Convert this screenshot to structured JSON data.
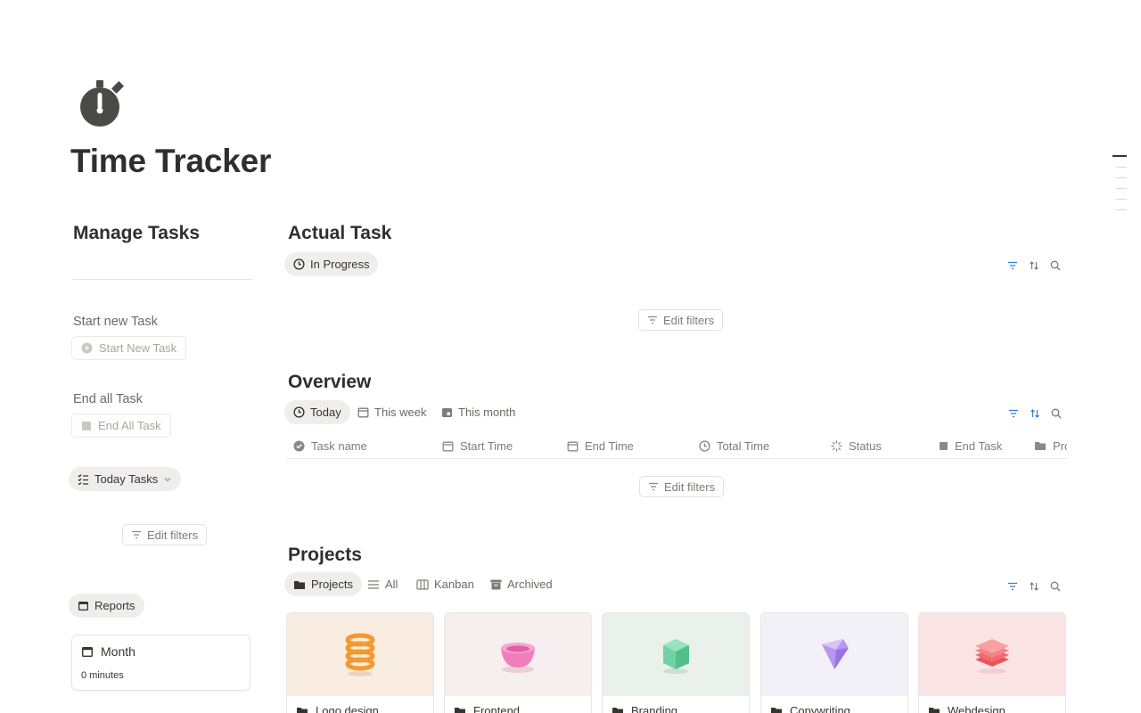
{
  "page": {
    "title": "Time Tracker",
    "icon": "stopwatch-icon"
  },
  "left": {
    "title": "Manage Tasks",
    "start_label": "Start new Task",
    "start_button": "Start New Task",
    "end_label": "End all Task",
    "end_button": "End All Task",
    "today_view": "Today Tasks",
    "edit_filters": "Edit filters",
    "reports_view": "Reports",
    "month_card": {
      "title": "Month",
      "value": "0 minutes"
    }
  },
  "actual_task": {
    "title": "Actual Task",
    "tab": "In Progress",
    "edit_filters": "Edit filters"
  },
  "overview": {
    "title": "Overview",
    "tabs": [
      "Today",
      "This week",
      "This month"
    ],
    "columns": [
      "Task name",
      "Start Time",
      "End Time",
      "Total Time",
      "Status",
      "End Task",
      "Pro"
    ],
    "edit_filters": "Edit filters"
  },
  "projects": {
    "title": "Projects",
    "tabs": [
      "Projects",
      "All",
      "Kanban",
      "Archived"
    ],
    "cards": [
      {
        "name": "Logo design",
        "cover": "#f9ece0"
      },
      {
        "name": "Frontend",
        "cover": "#f7eef0"
      },
      {
        "name": "Branding",
        "cover": "#e9f1ea"
      },
      {
        "name": "Copywriting",
        "cover": "#f3f1f8"
      },
      {
        "name": "Webdesign",
        "cover": "#fbe4e4"
      }
    ]
  },
  "colors": {
    "accent": "#2e7cd6",
    "text": "#37352f",
    "muted": "#7d7c78",
    "pill_bg": "#efeeec"
  }
}
